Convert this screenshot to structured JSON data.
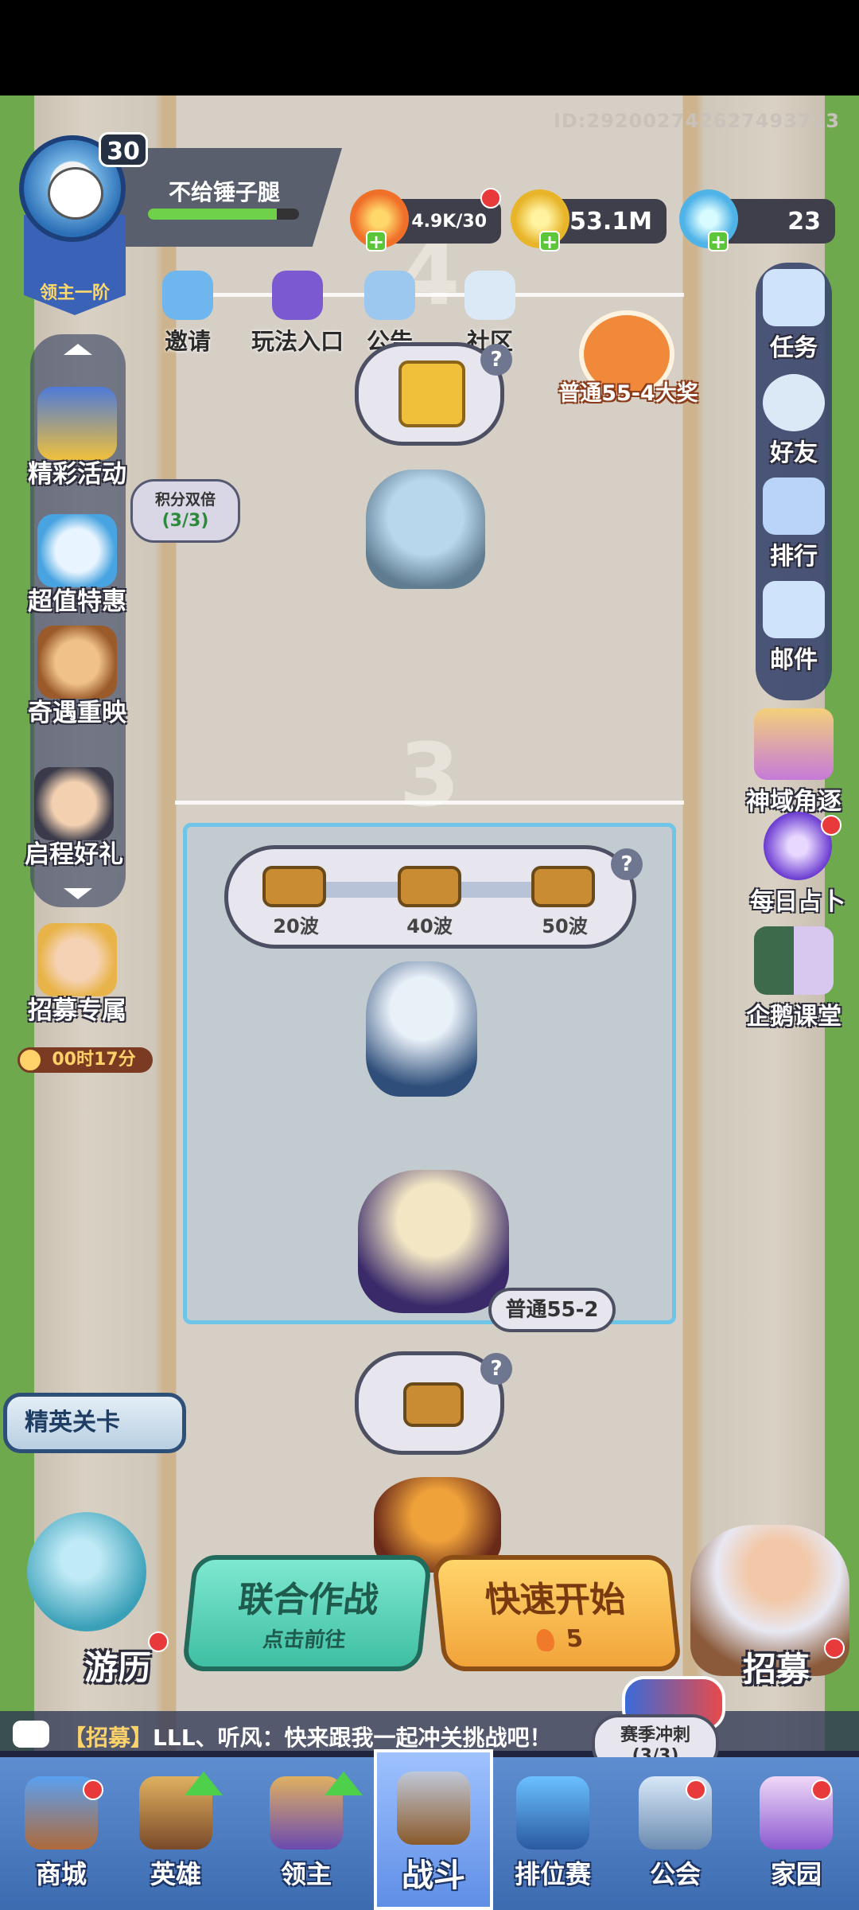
{
  "header": {
    "uid": "ID:292002742627493723"
  },
  "player": {
    "name": "不给锤子腿",
    "level": "30",
    "rank": "领主一阶",
    "hp_fraction": 0.85
  },
  "resources": {
    "stamina": "4.9K/30",
    "gold": "53.1M",
    "gems": "23"
  },
  "top_links": [
    {
      "label": "邀请",
      "icon": "penguin-invite-icon"
    },
    {
      "label": "玩法入口",
      "icon": "gamepad-monster-icon"
    },
    {
      "label": "公告",
      "icon": "megaphone-icon"
    },
    {
      "label": "社区",
      "icon": "community-yeti-icon"
    }
  ],
  "left_menu": [
    {
      "label": "精彩活动",
      "icon": "treasure-chest-icon"
    },
    {
      "label": "超值特惠",
      "icon": "clock-deal-icon"
    },
    {
      "label": "奇遇重映",
      "icon": "bear-icon"
    },
    {
      "label": "启程好礼",
      "icon": "hero-gift-icon"
    },
    {
      "label": "招募专属",
      "icon": "recruit-hero-icon"
    }
  ],
  "score_bubble": {
    "title": "积分双倍",
    "value": "(3/3)"
  },
  "recruit_timer": "00时17分",
  "right_menu": [
    {
      "label": "任务",
      "icon": "clipboard-icon"
    },
    {
      "label": "好友",
      "icon": "friend-icon"
    },
    {
      "label": "排行",
      "icon": "podium-icon"
    },
    {
      "label": "邮件",
      "icon": "mail-icon"
    },
    {
      "label": "神域角逐",
      "icon": "wings-crest-icon"
    },
    {
      "label": "每日占卜",
      "icon": "crystal-ball-icon"
    },
    {
      "label": "企鹅课堂",
      "icon": "penguin-teacher-icon"
    }
  ],
  "stages": {
    "upper_number": "4",
    "current_number": "3",
    "reward_label": "普通55-4大奖",
    "chests": [
      "20波",
      "40波",
      "50波"
    ],
    "current_tag": "普通55-2",
    "help": "?"
  },
  "buttons": {
    "coop_title": "联合作战",
    "coop_sub": "点击前往",
    "quick_title": "快速开始",
    "quick_cost": "5",
    "elite": "精英关卡",
    "tour": "游历",
    "recruit": "招募"
  },
  "chat": {
    "tag": "【招募】",
    "message": "LLL、听风：快来跟我一起冲关挑战吧！"
  },
  "season": {
    "title": "赛季冲刺",
    "value": "(3/3)"
  },
  "nav": [
    {
      "label": "商城",
      "icon": "shop-chest-icon"
    },
    {
      "label": "英雄",
      "icon": "hero-card-icon"
    },
    {
      "label": "领主",
      "icon": "lord-banner-icon"
    },
    {
      "label": "战斗",
      "icon": "battle-weapons-icon",
      "active": true
    },
    {
      "label": "排位赛",
      "icon": "ranked-shield-icon"
    },
    {
      "label": "公会",
      "icon": "guild-icon"
    },
    {
      "label": "家园",
      "icon": "castle-home-icon"
    }
  ]
}
